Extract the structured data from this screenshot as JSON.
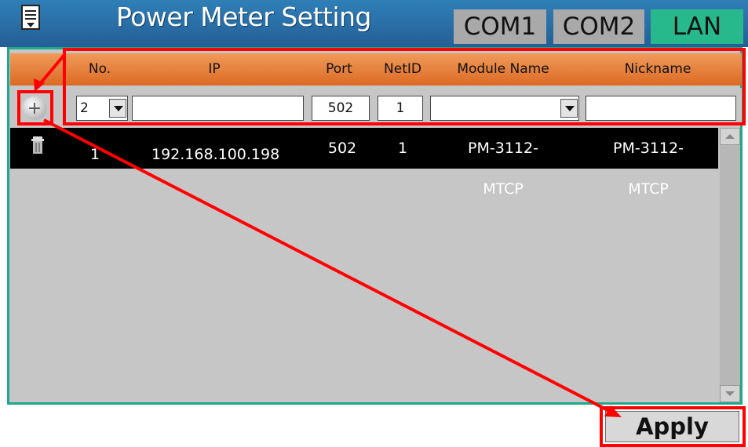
{
  "header": {
    "title": "Power Meter Setting",
    "tabs": [
      {
        "label": "COM1"
      },
      {
        "label": "COM2"
      },
      {
        "label": "LAN"
      }
    ],
    "active_tab": "LAN"
  },
  "table": {
    "columns": [
      "No.",
      "IP",
      "Port",
      "NetID",
      "Module Name",
      "Nickname"
    ],
    "input_row": {
      "no_value": "2",
      "ip_value": "",
      "port_value": "502",
      "netid_value": "1",
      "module_value": "",
      "nickname_value": ""
    },
    "rows": [
      {
        "no": "1",
        "ip": "192.168.100.198",
        "port": "502",
        "netid": "1",
        "module": "PM-3112-MTCP",
        "nickname": "PM-3112-MTCP"
      }
    ]
  },
  "apply_label": "Apply",
  "colors": {
    "topbar": "#2f7fb7",
    "header": "#e57a35",
    "active_tab": "#27b88c",
    "panel_border": "#1fa88b",
    "annotation": "#ff0000"
  },
  "icons": [
    "menu-icon",
    "add-icon",
    "trash-icon",
    "dropdown-arrow-icon",
    "scroll-up-icon",
    "scroll-down-icon"
  ]
}
